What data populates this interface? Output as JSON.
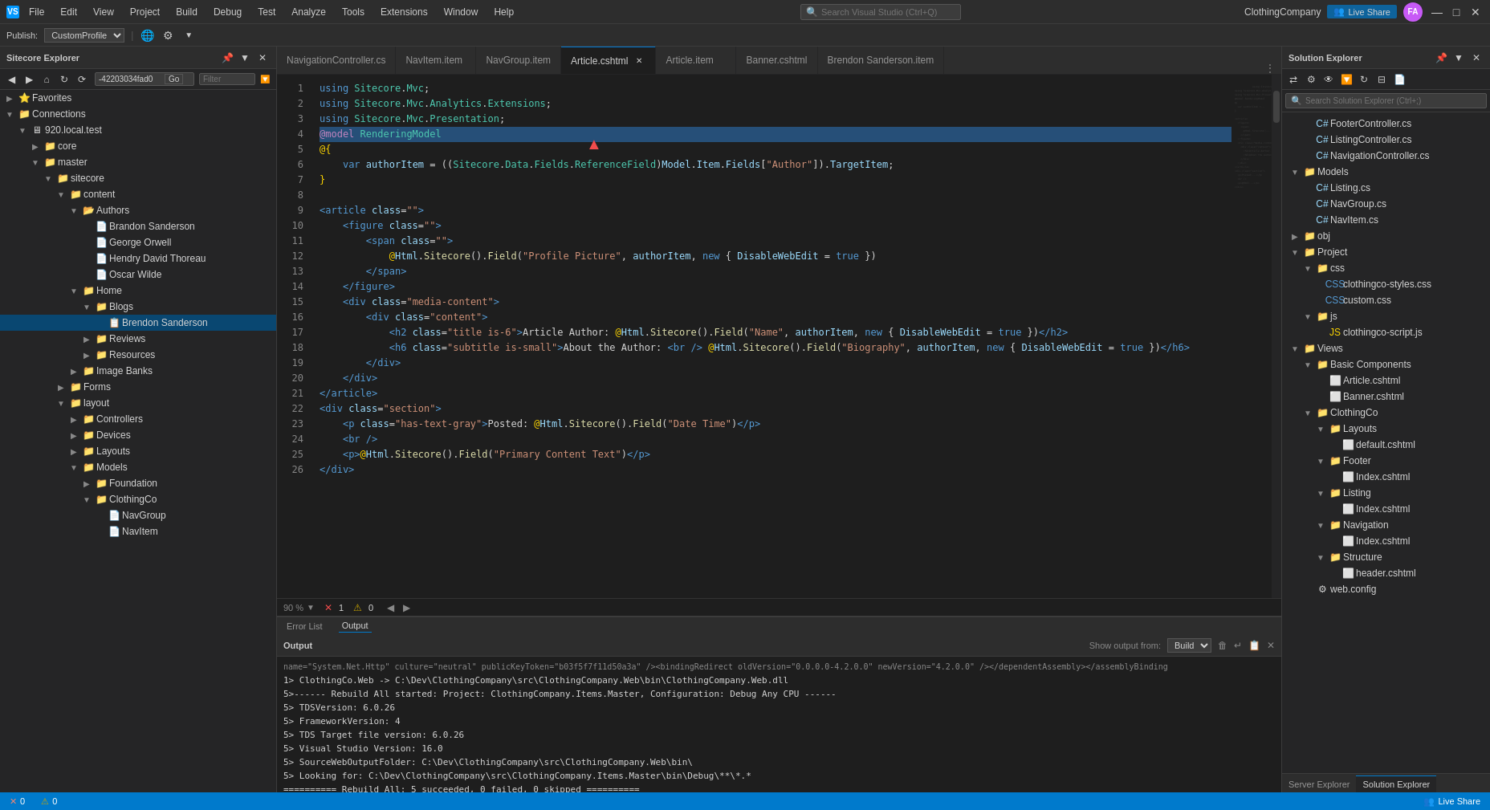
{
  "app": {
    "title": "Visual Studio",
    "project_name": "ClothingCompany"
  },
  "title_bar": {
    "menus": [
      "File",
      "Edit",
      "View",
      "Project",
      "Build",
      "Debug",
      "Test",
      "Analyze",
      "Tools",
      "Extensions",
      "Window",
      "Help"
    ],
    "search_placeholder": "Search Visual Studio (Ctrl+Q)",
    "profile_initials": "FA",
    "live_share_label": "Live Share",
    "window_controls": [
      "—",
      "□",
      "✕"
    ]
  },
  "toolbar": {
    "publish_label": "Publish:",
    "profile_value": "CustomProfile"
  },
  "sitecore_panel": {
    "title": "Sitecore Explorer",
    "path_value": "-42203034fad0",
    "go_label": "Go",
    "filter_placeholder": "Filter",
    "tree": [
      {
        "id": "favorites",
        "label": "Favorites",
        "level": 0,
        "type": "folder",
        "expanded": false
      },
      {
        "id": "connections",
        "label": "Connections",
        "level": 0,
        "type": "folder",
        "expanded": true
      },
      {
        "id": "920",
        "label": "920.local.test",
        "level": 1,
        "type": "server",
        "expanded": true
      },
      {
        "id": "core",
        "label": "core",
        "level": 2,
        "type": "folder",
        "expanded": false
      },
      {
        "id": "master",
        "label": "master",
        "level": 2,
        "type": "folder",
        "expanded": true
      },
      {
        "id": "sitecore",
        "label": "sitecore",
        "level": 3,
        "type": "folder",
        "expanded": true
      },
      {
        "id": "content",
        "label": "content",
        "level": 4,
        "type": "folder",
        "expanded": true
      },
      {
        "id": "authors",
        "label": "Authors",
        "level": 5,
        "type": "folder",
        "expanded": true
      },
      {
        "id": "brandon",
        "label": "Brandon Sanderson",
        "level": 6,
        "type": "item",
        "expanded": false
      },
      {
        "id": "george",
        "label": "George Orwell",
        "level": 6,
        "type": "item",
        "expanded": false
      },
      {
        "id": "hendry",
        "label": "Hendry David Thoreau",
        "level": 6,
        "type": "item",
        "expanded": false
      },
      {
        "id": "oscar",
        "label": "Oscar Wilde",
        "level": 6,
        "type": "item",
        "expanded": false
      },
      {
        "id": "home",
        "label": "Home",
        "level": 5,
        "type": "folder",
        "expanded": true
      },
      {
        "id": "blogs",
        "label": "Blogs",
        "level": 6,
        "type": "folder",
        "expanded": true
      },
      {
        "id": "brandon-blog",
        "label": "Brendon Sanderson",
        "level": 7,
        "type": "item-selected",
        "expanded": false
      },
      {
        "id": "reviews",
        "label": "Reviews",
        "level": 6,
        "type": "folder",
        "expanded": false
      },
      {
        "id": "resources",
        "label": "Resources",
        "level": 6,
        "type": "folder",
        "expanded": false
      },
      {
        "id": "image-banks",
        "label": "Image Banks",
        "level": 5,
        "type": "folder",
        "expanded": false
      },
      {
        "id": "forms",
        "label": "Forms",
        "level": 4,
        "type": "folder",
        "expanded": false
      },
      {
        "id": "layout",
        "label": "layout",
        "level": 4,
        "type": "folder",
        "expanded": true
      },
      {
        "id": "controllers",
        "label": "Controllers",
        "level": 5,
        "type": "folder",
        "expanded": false
      },
      {
        "id": "devices",
        "label": "Devices",
        "level": 5,
        "type": "folder",
        "expanded": false
      },
      {
        "id": "layouts",
        "label": "Layouts",
        "level": 5,
        "type": "folder",
        "expanded": false
      },
      {
        "id": "models",
        "label": "Models",
        "level": 5,
        "type": "folder",
        "expanded": true
      },
      {
        "id": "foundation",
        "label": "Foundation",
        "level": 6,
        "type": "folder",
        "expanded": false
      },
      {
        "id": "clothingco-models",
        "label": "ClothingCo",
        "level": 6,
        "type": "folder",
        "expanded": true
      },
      {
        "id": "navgroup",
        "label": "NavGroup",
        "level": 7,
        "type": "item",
        "expanded": false
      },
      {
        "id": "navitem",
        "label": "NavItem",
        "level": 7,
        "type": "item",
        "expanded": false
      }
    ]
  },
  "tabs": [
    {
      "id": "navigation-controller",
      "label": "NavigationController.cs",
      "active": false,
      "modified": false
    },
    {
      "id": "nav-item",
      "label": "NavItem.item",
      "active": false,
      "modified": false
    },
    {
      "id": "nav-group",
      "label": "NavGroup.item",
      "active": false,
      "modified": false
    },
    {
      "id": "article-cshtml",
      "label": "Article.cshtml",
      "active": true,
      "modified": false
    },
    {
      "id": "article-item",
      "label": "Article.item",
      "active": false,
      "modified": false
    },
    {
      "id": "banner-cshtml",
      "label": "Banner.cshtml",
      "active": false,
      "modified": false
    },
    {
      "id": "brendan-item",
      "label": "Brendon Sanderson.item",
      "active": false,
      "modified": false
    }
  ],
  "code": {
    "lines": [
      {
        "num": 1,
        "content": "using Sitecore.Mvc;"
      },
      {
        "num": 2,
        "content": "using Sitecore.Mvc.Analytics.Extensions;"
      },
      {
        "num": 3,
        "content": "using Sitecore.Mvc.Presentation;"
      },
      {
        "num": 4,
        "content": "@model RenderingModel"
      },
      {
        "num": 5,
        "content": "{"
      },
      {
        "num": 6,
        "content": "    var authorItem = ((Sitecore.Data.Fields.ReferenceField)Model.Item.Fields[\"Author\"]).TargetItem;"
      },
      {
        "num": 7,
        "content": "}"
      },
      {
        "num": 8,
        "content": ""
      },
      {
        "num": 9,
        "content": "<article class=\"\">"
      },
      {
        "num": 10,
        "content": "    <figure class=\"\">"
      },
      {
        "num": 11,
        "content": "        <span class=\"\">"
      },
      {
        "num": 12,
        "content": "            @Html.Sitecore().Field(\"Profile Picture\", authorItem, new { DisableWebEdit = true })"
      },
      {
        "num": 13,
        "content": "        </span>"
      },
      {
        "num": 14,
        "content": "    </figure>"
      },
      {
        "num": 15,
        "content": "    <div class=\"media-content\">"
      },
      {
        "num": 16,
        "content": "        <div class=\"content\">"
      },
      {
        "num": 17,
        "content": "            <h2 class=\"title is-6\">Article Author: @Html.Sitecore().Field(\"Name\", authorItem, new { DisableWebEdit = true })</h2>"
      },
      {
        "num": 18,
        "content": "            <h6 class=\"subtitle is-small\">About the Author: <br /> @Html.Sitecore().Field(\"Biography\", authorItem, new { DisableWebEdit = true })</h6>"
      },
      {
        "num": 19,
        "content": "        </div>"
      },
      {
        "num": 20,
        "content": "    </div>"
      },
      {
        "num": 21,
        "content": "</article>"
      },
      {
        "num": 22,
        "content": "<div class=\"section\">"
      },
      {
        "num": 23,
        "content": "    <p class=\"has-text-gray\">Posted: @Html.Sitecore().Field(\"Date Time\")</p>"
      },
      {
        "num": 24,
        "content": "    <br />"
      },
      {
        "num": 25,
        "content": "    <p>@Html.Sitecore().Field(\"Primary Content Text\")</p>"
      },
      {
        "num": 26,
        "content": "</div>"
      }
    ],
    "zoom": "90 %",
    "error_count": "1",
    "warning_count": "0"
  },
  "solution_explorer": {
    "title": "Solution Explorer",
    "search_placeholder": "Search Solution Explorer (Ctrl+;)",
    "tree": [
      {
        "label": "FooterController.cs",
        "level": 1,
        "type": "cs-file"
      },
      {
        "label": "ListingController.cs",
        "level": 1,
        "type": "cs-file"
      },
      {
        "label": "NavigationController.cs",
        "level": 1,
        "type": "cs-file"
      },
      {
        "label": "Models",
        "level": 0,
        "type": "folder",
        "expanded": true
      },
      {
        "label": "Listing.cs",
        "level": 1,
        "type": "cs-file"
      },
      {
        "label": "NavGroup.cs",
        "level": 1,
        "type": "cs-file"
      },
      {
        "label": "NavItem.cs",
        "level": 1,
        "type": "cs-file"
      },
      {
        "label": "obj",
        "level": 0,
        "type": "folder",
        "expanded": false
      },
      {
        "label": "Project",
        "level": 0,
        "type": "folder",
        "expanded": true
      },
      {
        "label": "css",
        "level": 1,
        "type": "folder",
        "expanded": true
      },
      {
        "label": "clothingco-styles.css",
        "level": 2,
        "type": "css-file"
      },
      {
        "label": "custom.css",
        "level": 2,
        "type": "css-file"
      },
      {
        "label": "js",
        "level": 1,
        "type": "folder",
        "expanded": true
      },
      {
        "label": "clothingco-script.js",
        "level": 2,
        "type": "js-file"
      },
      {
        "label": "Views",
        "level": 0,
        "type": "folder",
        "expanded": true
      },
      {
        "label": "Basic Components",
        "level": 1,
        "type": "folder",
        "expanded": true
      },
      {
        "label": "Article.cshtml",
        "level": 2,
        "type": "cshtml-file"
      },
      {
        "label": "Banner.cshtml",
        "level": 2,
        "type": "cshtml-file"
      },
      {
        "label": "ClothingCo",
        "level": 1,
        "type": "folder",
        "expanded": true
      },
      {
        "label": "Layouts",
        "level": 2,
        "type": "folder",
        "expanded": true
      },
      {
        "label": "default.cshtml",
        "level": 3,
        "type": "cshtml-file"
      },
      {
        "label": "Footer",
        "level": 2,
        "type": "folder",
        "expanded": true
      },
      {
        "label": "Index.cshtml",
        "level": 3,
        "type": "cshtml-file"
      },
      {
        "label": "Listing",
        "level": 2,
        "type": "folder",
        "expanded": true
      },
      {
        "label": "Index.cshtml",
        "level": 3,
        "type": "cshtml-file"
      },
      {
        "label": "Navigation",
        "level": 2,
        "type": "folder",
        "expanded": true
      },
      {
        "label": "Index.cshtml",
        "level": 3,
        "type": "cshtml-file"
      },
      {
        "label": "Structure",
        "level": 2,
        "type": "folder",
        "expanded": true
      },
      {
        "label": "header.cshtml",
        "level": 3,
        "type": "cshtml-file"
      },
      {
        "label": "web.config",
        "level": 1,
        "type": "config-file"
      }
    ],
    "tabs": [
      {
        "label": "Server Explorer",
        "active": false
      },
      {
        "label": "Solution Explorer",
        "active": true
      }
    ]
  },
  "output": {
    "title": "Output",
    "show_output_from_label": "Show output from:",
    "show_output_from_value": "Build",
    "lines": [
      "    name=\"System.Net.Http\" culture=\"neutral\" publicKeyToken=\"b03f5f7f11d50a3a\" /><bindingRedirect oldVersion=\"0.0.0.0-4.2.0.0\" newVersion=\"4.2.0.0\" /></dependentAssembly></assemblyBinding",
      "ClothingCo.Web -> C:\\Dev\\ClothingCompany\\src\\ClothingCompany.Web\\bin\\ClothingCompany.Web.dll",
      "5>------ Rebuild All started: Project: ClothingCompany.Items.Master, Configuration: Debug Any CPU ------",
      "5>       TDSVersion: 6.0.26",
      "5>       FrameworkVersion: 4",
      "5>       TDS Target file version: 6.0.26",
      "5>       Visual Studio Version: 16.0",
      "5>              SourceWebOutputFolder: C:\\Dev\\ClothingCompany\\src\\ClothingCompany.Web\\bin\\",
      "5>       Looking for: C:\\Dev\\ClothingCompany\\src\\ClothingCompany.Items.Master\\bin\\Debug\\**\\*.*",
      "========== Rebuild All: 5 succeeded, 0 failed, 0 skipped =========="
    ]
  },
  "bottom_tabs": [
    {
      "label": "Error List",
      "active": false
    },
    {
      "label": "Output",
      "active": true
    }
  ],
  "status_bar": {
    "errors": "0",
    "warnings": "0"
  }
}
